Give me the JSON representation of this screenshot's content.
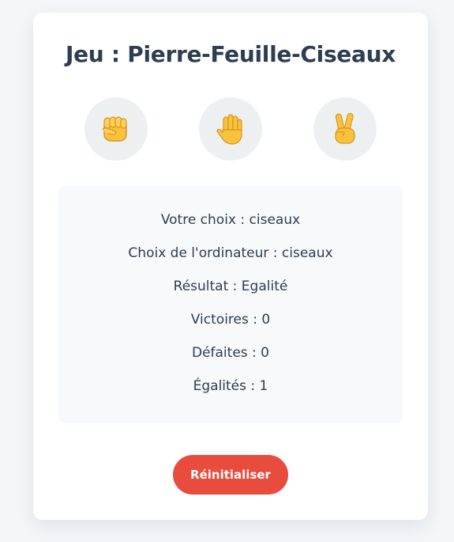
{
  "title": "Jeu : Pierre-Feuille-Ciseaux",
  "choices": [
    {
      "name": "pierre",
      "icon": "raised-fist-icon"
    },
    {
      "name": "feuille",
      "icon": "raised-hand-icon"
    },
    {
      "name": "ciseaux",
      "icon": "victory-hand-icon"
    }
  ],
  "results": {
    "votre_choix": "Votre choix : ciseaux",
    "choix_ordinateur": "Choix de l'ordinateur : ciseaux",
    "resultat": "Résultat : Egalité",
    "victoires": "Victoires : 0",
    "defaites": "Défaites : 0",
    "egalites": "Égalités : 1"
  },
  "reset_label": "Réinitialiser",
  "colors": {
    "title": "#2c3e50",
    "choice_bg": "#ecf0f1",
    "reset_bg": "#e74c3c",
    "emoji_yellow": "#f9c23c"
  }
}
